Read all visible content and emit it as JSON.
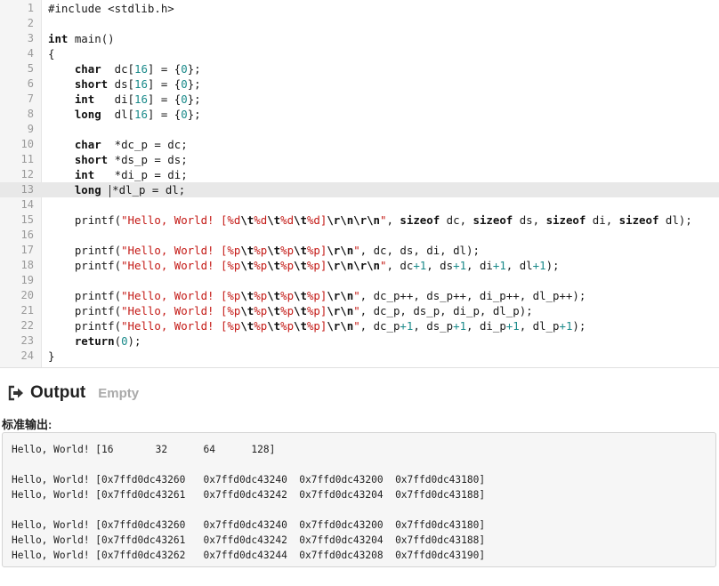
{
  "editor": {
    "active_line": 13,
    "lines": [
      {
        "n": "1",
        "t": [
          [
            "pp",
            "#include <stdlib.h>"
          ]
        ]
      },
      {
        "n": "2",
        "t": []
      },
      {
        "n": "3",
        "t": [
          [
            "kw",
            "int"
          ],
          [
            "p",
            " main()"
          ]
        ]
      },
      {
        "n": "4",
        "t": [
          [
            "p",
            "{"
          ]
        ]
      },
      {
        "n": "5",
        "t": [
          [
            "p",
            "    "
          ],
          [
            "kw",
            "char"
          ],
          [
            "p",
            "  dc["
          ],
          [
            "num",
            "16"
          ],
          [
            "p",
            "] = {"
          ],
          [
            "num",
            "0"
          ],
          [
            "p",
            "};"
          ]
        ]
      },
      {
        "n": "6",
        "t": [
          [
            "p",
            "    "
          ],
          [
            "kw",
            "short"
          ],
          [
            "p",
            " ds["
          ],
          [
            "num",
            "16"
          ],
          [
            "p",
            "] = {"
          ],
          [
            "num",
            "0"
          ],
          [
            "p",
            "};"
          ]
        ]
      },
      {
        "n": "7",
        "t": [
          [
            "p",
            "    "
          ],
          [
            "kw",
            "int"
          ],
          [
            "p",
            "   di["
          ],
          [
            "num",
            "16"
          ],
          [
            "p",
            "] = {"
          ],
          [
            "num",
            "0"
          ],
          [
            "p",
            "};"
          ]
        ]
      },
      {
        "n": "8",
        "t": [
          [
            "p",
            "    "
          ],
          [
            "kw",
            "long"
          ],
          [
            "p",
            "  dl["
          ],
          [
            "num",
            "16"
          ],
          [
            "p",
            "] = {"
          ],
          [
            "num",
            "0"
          ],
          [
            "p",
            "};"
          ]
        ]
      },
      {
        "n": "9",
        "t": []
      },
      {
        "n": "10",
        "t": [
          [
            "p",
            "    "
          ],
          [
            "kw",
            "char"
          ],
          [
            "p",
            "  *dc_p = dc;"
          ]
        ]
      },
      {
        "n": "11",
        "t": [
          [
            "p",
            "    "
          ],
          [
            "kw",
            "short"
          ],
          [
            "p",
            " *ds_p = ds;"
          ]
        ]
      },
      {
        "n": "12",
        "t": [
          [
            "p",
            "    "
          ],
          [
            "kw",
            "int"
          ],
          [
            "p",
            "   *di_p = di;"
          ]
        ]
      },
      {
        "n": "13",
        "t": [
          [
            "p",
            "    "
          ],
          [
            "kw",
            "long"
          ],
          [
            "p",
            " "
          ],
          [
            "cur",
            ""
          ],
          [
            "p",
            "*dl_p = dl;"
          ]
        ]
      },
      {
        "n": "14",
        "t": []
      },
      {
        "n": "15",
        "t": [
          [
            "p",
            "    printf("
          ],
          [
            "str",
            "\"Hello, World! [%d"
          ],
          [
            "esc",
            "\\t"
          ],
          [
            "str",
            "%d"
          ],
          [
            "esc",
            "\\t"
          ],
          [
            "str",
            "%d"
          ],
          [
            "esc",
            "\\t"
          ],
          [
            "str",
            "%d]"
          ],
          [
            "esc",
            "\\r\\n\\r\\n"
          ],
          [
            "str",
            "\""
          ],
          [
            "p",
            ", "
          ],
          [
            "kw",
            "sizeof"
          ],
          [
            "p",
            " dc, "
          ],
          [
            "kw",
            "sizeof"
          ],
          [
            "p",
            " ds, "
          ],
          [
            "kw",
            "sizeof"
          ],
          [
            "p",
            " di, "
          ],
          [
            "kw",
            "sizeof"
          ],
          [
            "p",
            " dl);"
          ]
        ]
      },
      {
        "n": "16",
        "t": []
      },
      {
        "n": "17",
        "t": [
          [
            "p",
            "    printf("
          ],
          [
            "str",
            "\"Hello, World! [%p"
          ],
          [
            "esc",
            "\\t"
          ],
          [
            "str",
            "%p"
          ],
          [
            "esc",
            "\\t"
          ],
          [
            "str",
            "%p"
          ],
          [
            "esc",
            "\\t"
          ],
          [
            "str",
            "%p]"
          ],
          [
            "esc",
            "\\r\\n"
          ],
          [
            "str",
            "\""
          ],
          [
            "p",
            ", dc, ds, di, dl);"
          ]
        ]
      },
      {
        "n": "18",
        "t": [
          [
            "p",
            "    printf("
          ],
          [
            "str",
            "\"Hello, World! [%p"
          ],
          [
            "esc",
            "\\t"
          ],
          [
            "str",
            "%p"
          ],
          [
            "esc",
            "\\t"
          ],
          [
            "str",
            "%p"
          ],
          [
            "esc",
            "\\t"
          ],
          [
            "str",
            "%p]"
          ],
          [
            "esc",
            "\\r\\n\\r\\n"
          ],
          [
            "str",
            "\""
          ],
          [
            "p",
            ", dc"
          ],
          [
            "num",
            "+1"
          ],
          [
            "p",
            ", ds"
          ],
          [
            "num",
            "+1"
          ],
          [
            "p",
            ", di"
          ],
          [
            "num",
            "+1"
          ],
          [
            "p",
            ", dl"
          ],
          [
            "num",
            "+1"
          ],
          [
            "p",
            ");"
          ]
        ]
      },
      {
        "n": "19",
        "t": []
      },
      {
        "n": "20",
        "t": [
          [
            "p",
            "    printf("
          ],
          [
            "str",
            "\"Hello, World! [%p"
          ],
          [
            "esc",
            "\\t"
          ],
          [
            "str",
            "%p"
          ],
          [
            "esc",
            "\\t"
          ],
          [
            "str",
            "%p"
          ],
          [
            "esc",
            "\\t"
          ],
          [
            "str",
            "%p]"
          ],
          [
            "esc",
            "\\r\\n"
          ],
          [
            "str",
            "\""
          ],
          [
            "p",
            ", dc_p++, ds_p++, di_p++, dl_p++);"
          ]
        ]
      },
      {
        "n": "21",
        "t": [
          [
            "p",
            "    printf("
          ],
          [
            "str",
            "\"Hello, World! [%p"
          ],
          [
            "esc",
            "\\t"
          ],
          [
            "str",
            "%p"
          ],
          [
            "esc",
            "\\t"
          ],
          [
            "str",
            "%p"
          ],
          [
            "esc",
            "\\t"
          ],
          [
            "str",
            "%p]"
          ],
          [
            "esc",
            "\\r\\n"
          ],
          [
            "str",
            "\""
          ],
          [
            "p",
            ", dc_p, ds_p, di_p, dl_p);"
          ]
        ]
      },
      {
        "n": "22",
        "t": [
          [
            "p",
            "    printf("
          ],
          [
            "str",
            "\"Hello, World! [%p"
          ],
          [
            "esc",
            "\\t"
          ],
          [
            "str",
            "%p"
          ],
          [
            "esc",
            "\\t"
          ],
          [
            "str",
            "%p"
          ],
          [
            "esc",
            "\\t"
          ],
          [
            "str",
            "%p]"
          ],
          [
            "esc",
            "\\r\\n"
          ],
          [
            "str",
            "\""
          ],
          [
            "p",
            ", dc_p"
          ],
          [
            "num",
            "+1"
          ],
          [
            "p",
            ", ds_p"
          ],
          [
            "num",
            "+1"
          ],
          [
            "p",
            ", di_p"
          ],
          [
            "num",
            "+1"
          ],
          [
            "p",
            ", dl_p"
          ],
          [
            "num",
            "+1"
          ],
          [
            "p",
            ");"
          ]
        ]
      },
      {
        "n": "23",
        "t": [
          [
            "p",
            "    "
          ],
          [
            "kw",
            "return"
          ],
          [
            "p",
            "("
          ],
          [
            "num",
            "0"
          ],
          [
            "p",
            ");"
          ]
        ]
      },
      {
        "n": "24",
        "t": [
          [
            "p",
            "}"
          ]
        ]
      }
    ]
  },
  "output": {
    "icon": "sign-out-icon",
    "title": "Output",
    "status": "Empty",
    "stdout_label": "标准输出:",
    "lines": [
      "Hello, World! [16       32      64      128]",
      "",
      "Hello, World! [0x7ffd0dc43260   0x7ffd0dc43240  0x7ffd0dc43200  0x7ffd0dc43180]",
      "Hello, World! [0x7ffd0dc43261   0x7ffd0dc43242  0x7ffd0dc43204  0x7ffd0dc43188]",
      "",
      "Hello, World! [0x7ffd0dc43260   0x7ffd0dc43240  0x7ffd0dc43200  0x7ffd0dc43180]",
      "Hello, World! [0x7ffd0dc43261   0x7ffd0dc43242  0x7ffd0dc43204  0x7ffd0dc43188]",
      "Hello, World! [0x7ffd0dc43262   0x7ffd0dc43244  0x7ffd0dc43208  0x7ffd0dc43190]"
    ]
  }
}
